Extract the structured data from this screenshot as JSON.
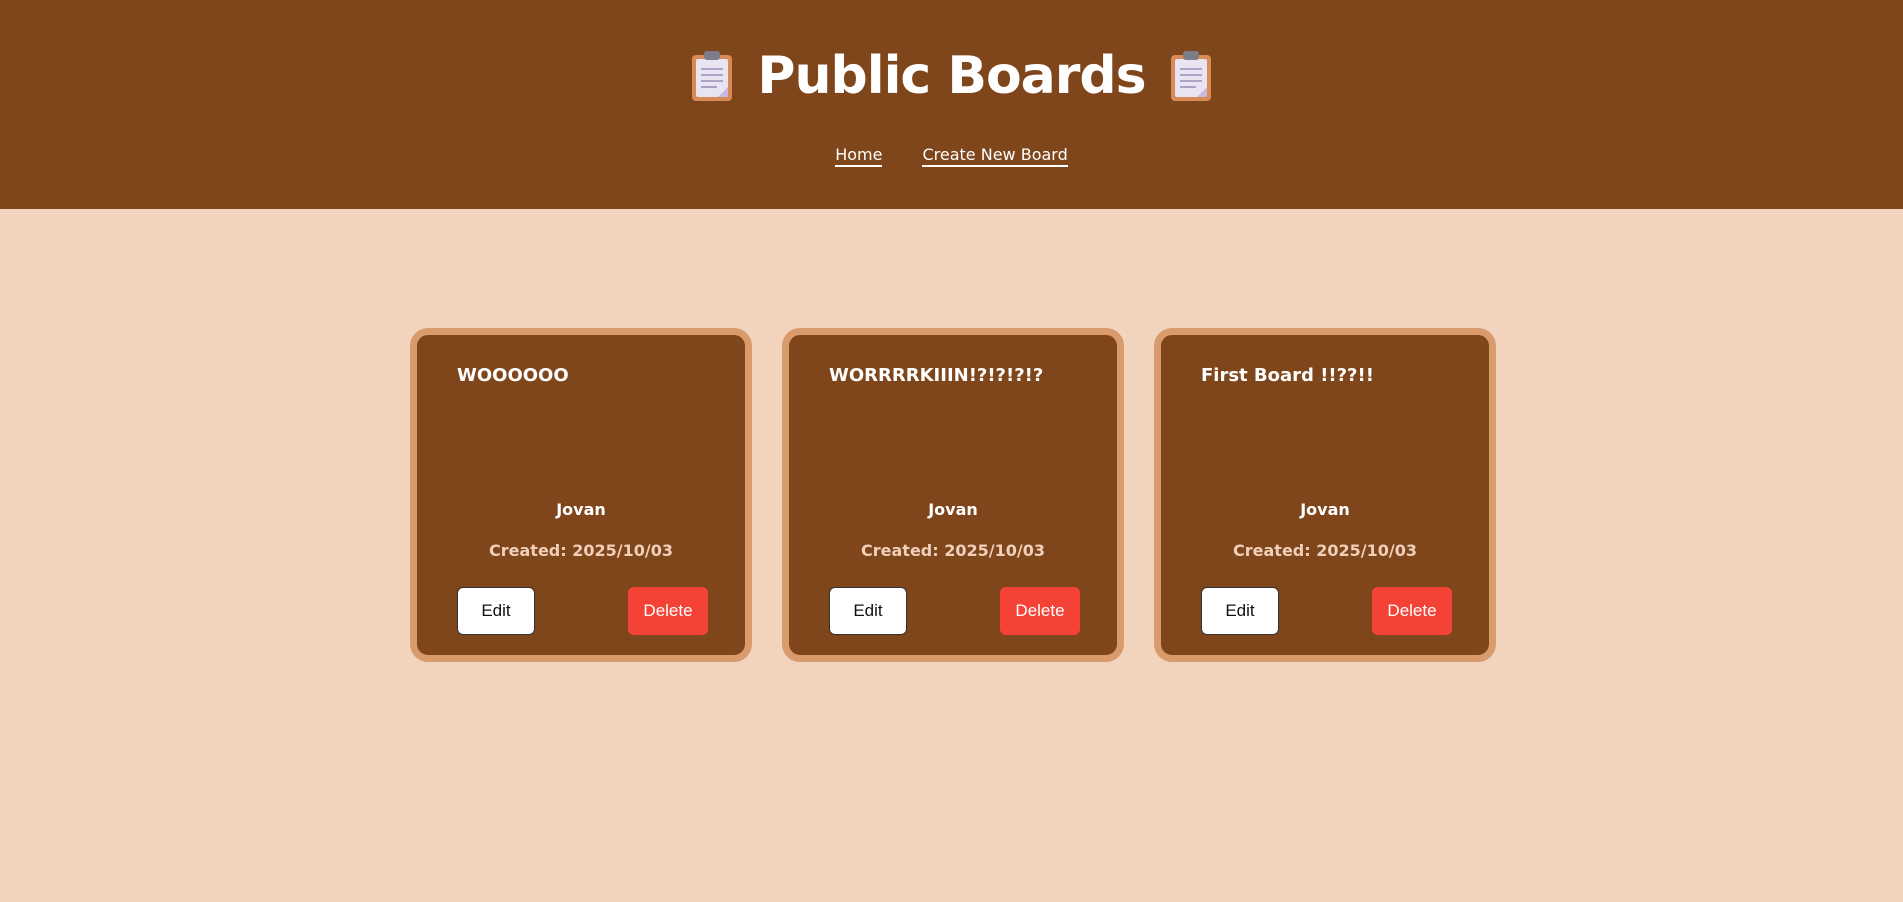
{
  "header": {
    "title": "Public Boards",
    "left_icon": "clipboard-icon",
    "right_icon": "clipboard-icon",
    "background_color": "#80461b"
  },
  "nav": {
    "home_label": "Home",
    "create_label": "Create New Board"
  },
  "page": {
    "background_color": "#f2d3bd"
  },
  "boards": [
    {
      "title": "WOOOOOO",
      "author": "Jovan",
      "created": "Created: 2025/10/03",
      "edit_label": "Edit",
      "delete_label": "Delete"
    },
    {
      "title": "WORRRRKIIIN!?!?!?!?",
      "author": "Jovan",
      "created": "Created: 2025/10/03",
      "edit_label": "Edit",
      "delete_label": "Delete"
    },
    {
      "title": "First Board !!??!!",
      "author": "Jovan",
      "created": "Created: 2025/10/03",
      "edit_label": "Edit",
      "delete_label": "Delete"
    }
  ],
  "colors": {
    "card_background": "#80461b",
    "card_border": "#d99a6c",
    "delete_button": "#f44336",
    "edit_button": "#ffffff"
  }
}
